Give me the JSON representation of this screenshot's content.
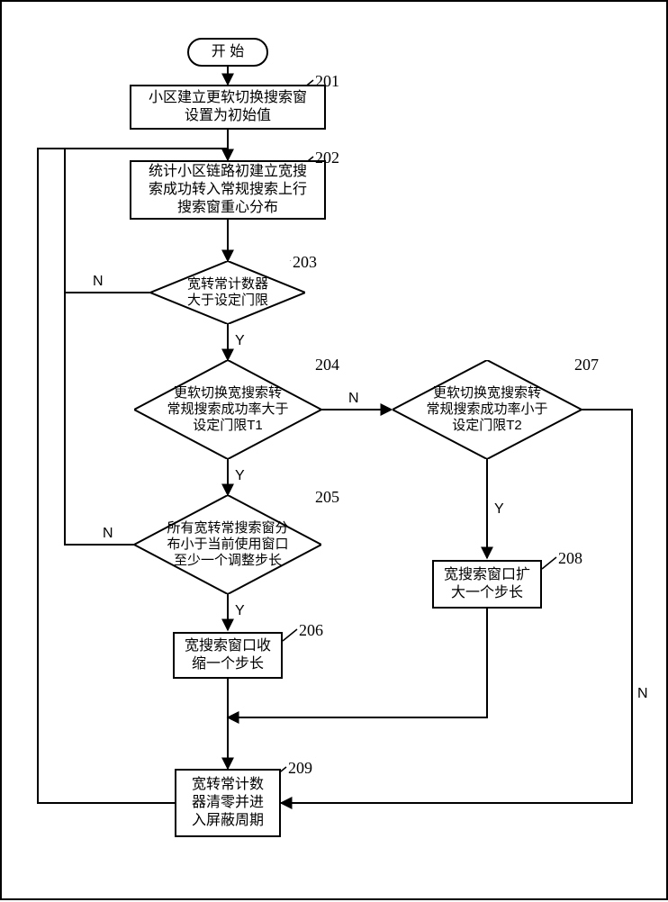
{
  "start": {
    "label": "开 始"
  },
  "n201": {
    "label": "小区建立更软切换搜索窗\n设置为初始值",
    "tag": "201"
  },
  "n202": {
    "label": "统计小区链路初建立宽搜\n索成功转入常规搜索上行\n搜索窗重心分布",
    "tag": "202"
  },
  "n203": {
    "label": "宽转常计数器\n大于设定门限",
    "tag": "203"
  },
  "n204": {
    "label": "更软切换宽搜索转\n常规搜索成功率大于\n设定门限T1",
    "tag": "204"
  },
  "n205": {
    "label": "所有宽转常搜索窗分\n布小于当前使用窗口\n至少一个调整步长",
    "tag": "205"
  },
  "n206": {
    "label": "宽搜索窗口收\n缩一个步长",
    "tag": "206"
  },
  "n207": {
    "label": "更软切换宽搜索转\n常规搜索成功率小于\n设定门限T2",
    "tag": "207"
  },
  "n208": {
    "label": "宽搜索窗口扩\n大一个步长",
    "tag": "208"
  },
  "n209": {
    "label": "宽转常计数\n器清零并进\n入屏蔽周期",
    "tag": "209"
  },
  "labels": {
    "Y": "Y",
    "N": "N"
  }
}
